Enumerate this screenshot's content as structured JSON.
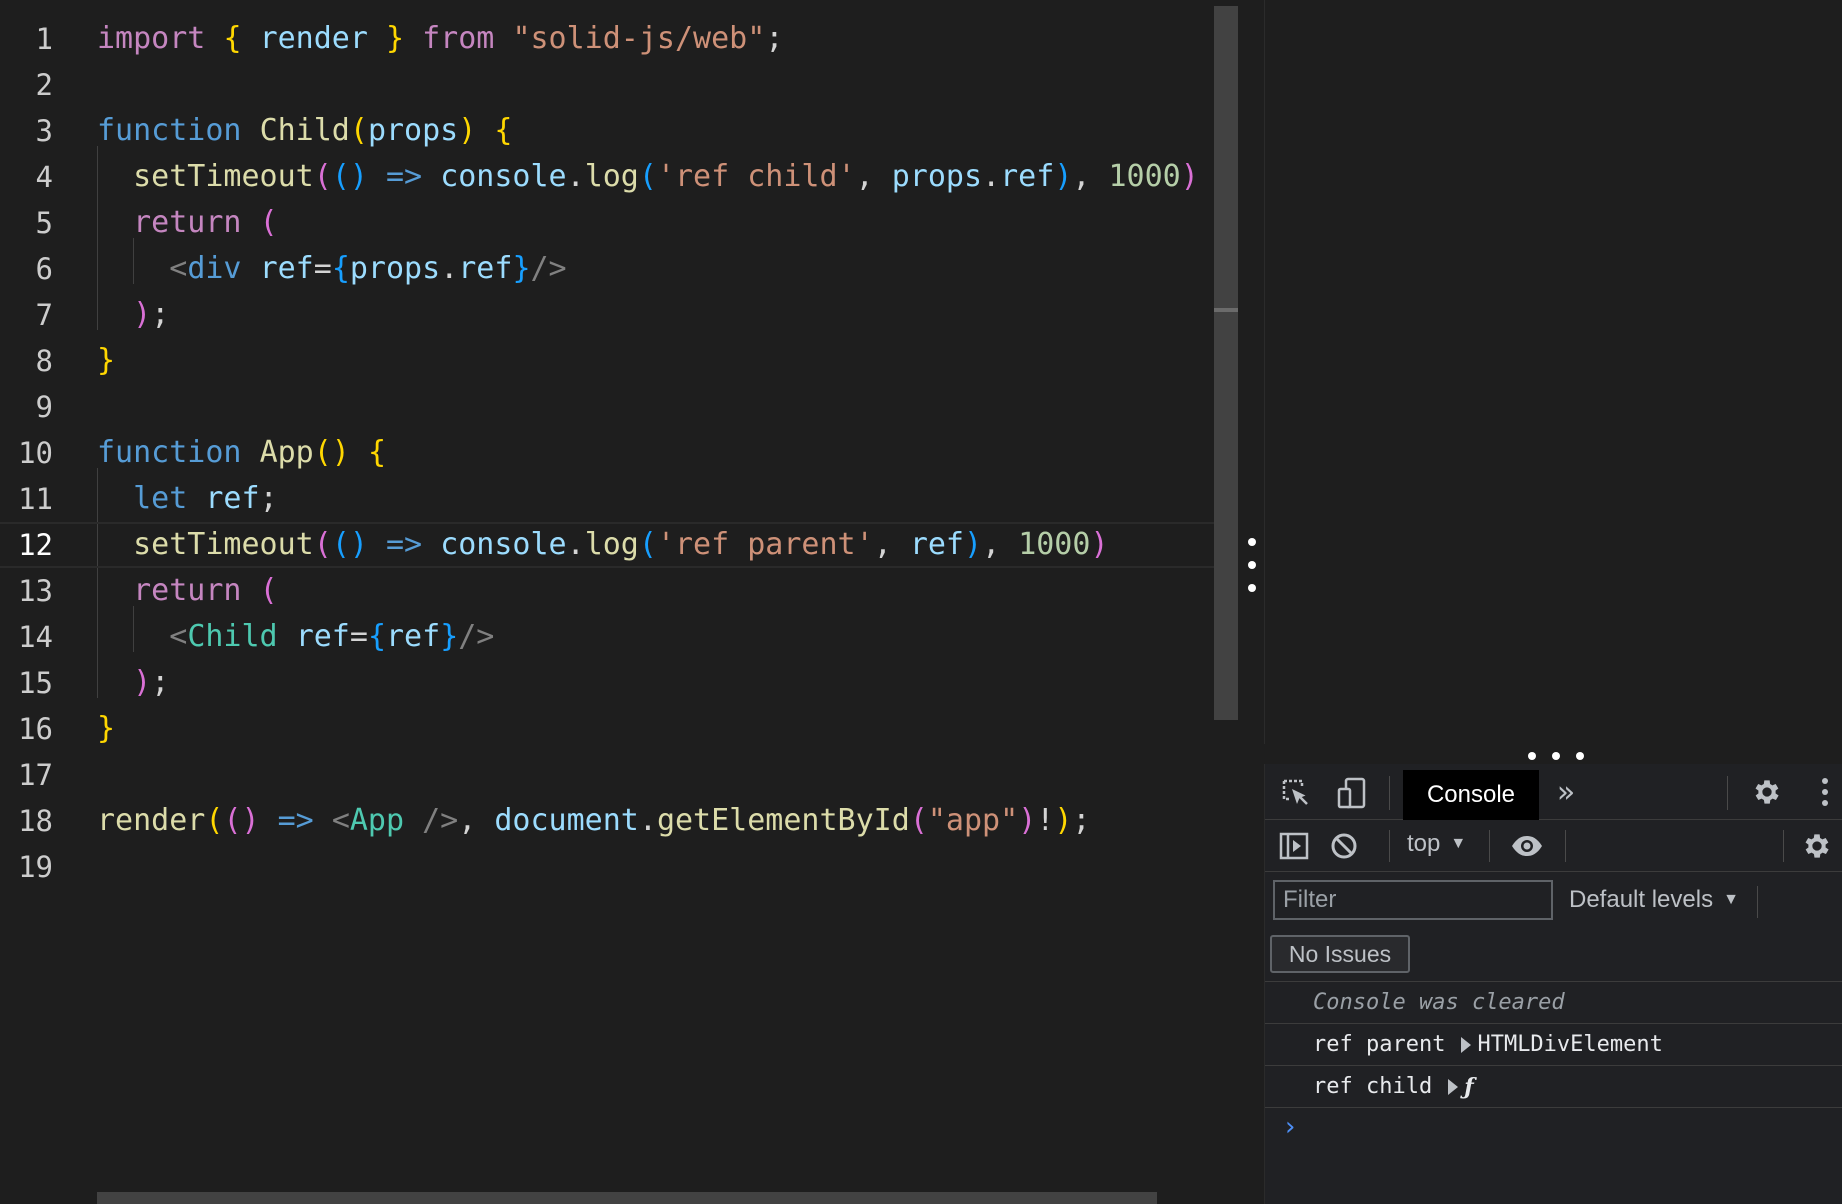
{
  "editor": {
    "active_line": 12,
    "line_numbers": [
      "1",
      "2",
      "3",
      "4",
      "5",
      "6",
      "7",
      "8",
      "9",
      "10",
      "11",
      "12",
      "13",
      "14",
      "15",
      "16",
      "17",
      "18",
      "19"
    ],
    "lines": [
      [
        [
          "kw",
          "import "
        ],
        [
          "b1",
          "{ "
        ],
        [
          "var",
          "render"
        ],
        [
          "b1",
          " }"
        ],
        [
          "kw",
          " from "
        ],
        [
          "str",
          "\"solid-js/web\""
        ],
        [
          "pl",
          ";"
        ]
      ],
      [],
      [
        [
          "st",
          "function "
        ],
        [
          "fn",
          "Child"
        ],
        [
          "b1",
          "("
        ],
        [
          "var",
          "props"
        ],
        [
          "b1",
          ")"
        ],
        [
          "pl",
          " "
        ],
        [
          "b1",
          "{"
        ]
      ],
      [
        [
          "pl",
          "  "
        ],
        [
          "fn",
          "setTimeout"
        ],
        [
          "b2",
          "("
        ],
        [
          "b3",
          "()"
        ],
        [
          "pl",
          " "
        ],
        [
          "st",
          "=>"
        ],
        [
          "pl",
          " "
        ],
        [
          "var",
          "console"
        ],
        [
          "pl",
          "."
        ],
        [
          "fn",
          "log"
        ],
        [
          "b3",
          "("
        ],
        [
          "str",
          "'ref child'"
        ],
        [
          "pl",
          ", "
        ],
        [
          "var",
          "props"
        ],
        [
          "pl",
          "."
        ],
        [
          "var",
          "ref"
        ],
        [
          "b3",
          ")"
        ],
        [
          "pl",
          ", "
        ],
        [
          "num",
          "1000"
        ],
        [
          "b2",
          ")"
        ]
      ],
      [
        [
          "pl",
          "  "
        ],
        [
          "kw",
          "return "
        ],
        [
          "b2",
          "("
        ]
      ],
      [
        [
          "pl",
          "    "
        ],
        [
          "ang",
          "<"
        ],
        [
          "tag",
          "div"
        ],
        [
          "pl",
          " "
        ],
        [
          "var",
          "ref"
        ],
        [
          "pl",
          "="
        ],
        [
          "b3",
          "{"
        ],
        [
          "var",
          "props"
        ],
        [
          "pl",
          "."
        ],
        [
          "var",
          "ref"
        ],
        [
          "b3",
          "}"
        ],
        [
          "ang",
          "/>"
        ]
      ],
      [
        [
          "pl",
          "  "
        ],
        [
          "b2",
          ")"
        ],
        [
          "pl",
          ";"
        ]
      ],
      [
        [
          "b1",
          "}"
        ]
      ],
      [],
      [
        [
          "st",
          "function "
        ],
        [
          "fn",
          "App"
        ],
        [
          "b1",
          "()"
        ],
        [
          "pl",
          " "
        ],
        [
          "b1",
          "{"
        ]
      ],
      [
        [
          "pl",
          "  "
        ],
        [
          "st",
          "let "
        ],
        [
          "var",
          "ref"
        ],
        [
          "pl",
          ";"
        ]
      ],
      [
        [
          "pl",
          "  "
        ],
        [
          "fn",
          "setTimeout"
        ],
        [
          "b2",
          "("
        ],
        [
          "b3",
          "()"
        ],
        [
          "pl",
          " "
        ],
        [
          "st",
          "=>"
        ],
        [
          "pl",
          " "
        ],
        [
          "var",
          "console"
        ],
        [
          "pl",
          "."
        ],
        [
          "fn",
          "log"
        ],
        [
          "b3",
          "("
        ],
        [
          "str",
          "'ref parent'"
        ],
        [
          "pl",
          ", "
        ],
        [
          "var",
          "ref"
        ],
        [
          "b3",
          ")"
        ],
        [
          "pl",
          ", "
        ],
        [
          "num",
          "1000"
        ],
        [
          "b2",
          ")"
        ]
      ],
      [
        [
          "pl",
          "  "
        ],
        [
          "kw",
          "return "
        ],
        [
          "b2",
          "("
        ]
      ],
      [
        [
          "pl",
          "    "
        ],
        [
          "ang",
          "<"
        ],
        [
          "cmp",
          "Child"
        ],
        [
          "pl",
          " "
        ],
        [
          "var",
          "ref"
        ],
        [
          "pl",
          "="
        ],
        [
          "b3",
          "{"
        ],
        [
          "var",
          "ref"
        ],
        [
          "b3",
          "}"
        ],
        [
          "ang",
          "/>"
        ]
      ],
      [
        [
          "pl",
          "  "
        ],
        [
          "b2",
          ")"
        ],
        [
          "pl",
          ";"
        ]
      ],
      [
        [
          "b1",
          "}"
        ]
      ],
      [],
      [
        [
          "fn",
          "render"
        ],
        [
          "b1",
          "("
        ],
        [
          "b2",
          "()"
        ],
        [
          "pl",
          " "
        ],
        [
          "st",
          "=>"
        ],
        [
          "pl",
          " "
        ],
        [
          "ang",
          "<"
        ],
        [
          "cmp",
          "App"
        ],
        [
          "pl",
          " "
        ],
        [
          "ang",
          "/>"
        ],
        [
          "pl",
          ", "
        ],
        [
          "var",
          "document"
        ],
        [
          "pl",
          "."
        ],
        [
          "fn",
          "getElementById"
        ],
        [
          "b2",
          "("
        ],
        [
          "str",
          "\"app\""
        ],
        [
          "b2",
          ")"
        ],
        [
          "pl",
          "!"
        ],
        [
          "b1",
          ")"
        ],
        [
          "pl",
          ";"
        ]
      ],
      []
    ]
  },
  "devtools": {
    "tabs": {
      "active": "Console",
      "more": "»"
    },
    "toolbar": {
      "context": "top",
      "dropdown_glyph": "▼"
    },
    "filter": {
      "placeholder": "Filter",
      "levels": "Default levels"
    },
    "issues_label": "No Issues",
    "console": {
      "cleared": "Console was cleared",
      "messages": [
        {
          "text": "ref parent",
          "value": "HTMLDivElement"
        },
        {
          "text": "ref child",
          "value": "ƒ"
        }
      ],
      "prompt": "›"
    }
  },
  "colors": {
    "keyword": "#c586c0",
    "storage": "#569cd6",
    "function": "#dcdcaa",
    "string": "#ce9178",
    "number": "#b5cea8",
    "variable": "#9cdcfe",
    "component": "#4ec9b0",
    "prompt": "#4d8ff6"
  }
}
